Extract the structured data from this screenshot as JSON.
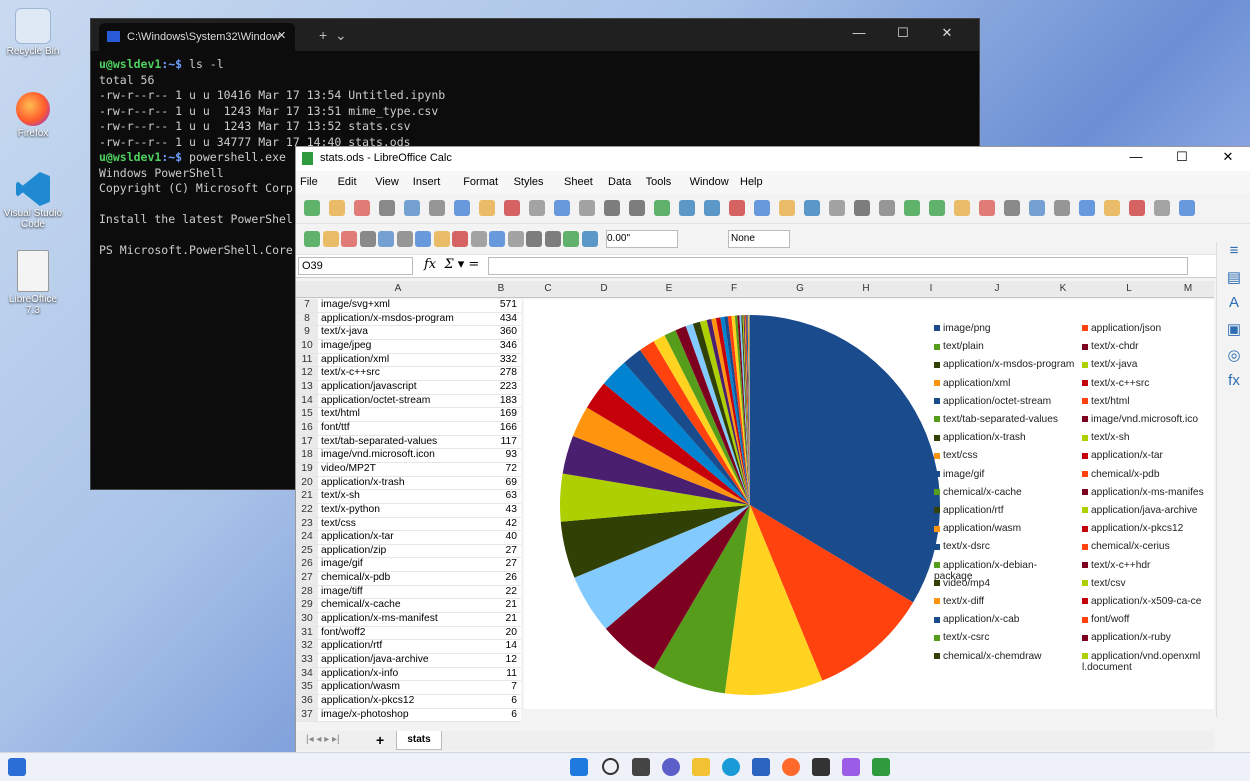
{
  "desktop": {
    "icons": [
      {
        "label": "Recycle Bin"
      },
      {
        "label": "Firefox"
      },
      {
        "label": "Visual Studio Code"
      },
      {
        "label": "LibreOffice 7.3"
      }
    ]
  },
  "terminal": {
    "tab_title": "C:\\Windows\\System32\\Window",
    "lines": [
      {
        "prompt": "u@wsldev1",
        "path": ":~$",
        "cmd": " ls -l"
      },
      {
        "text": "total 56"
      },
      {
        "text": "-rw-r--r-- 1 u u 10416 Mar 17 13:54 Untitled.ipynb"
      },
      {
        "text": "-rw-r--r-- 1 u u  1243 Mar 17 13:51 mime_type.csv"
      },
      {
        "text": "-rw-r--r-- 1 u u  1243 Mar 17 13:52 stats.csv"
      },
      {
        "text": "-rw-r--r-- 1 u u 34777 Mar 17 14:40 stats.ods"
      },
      {
        "prompt": "u@wsldev1",
        "path": ":~$",
        "cmd": " powershell.exe"
      },
      {
        "text": "Windows PowerShell"
      },
      {
        "text": "Copyright (C) Microsoft Corp"
      },
      {
        "text": ""
      },
      {
        "text": "Install the latest PowerShel"
      },
      {
        "text": ""
      },
      {
        "text": "PS Microsoft.PowerShell.Core"
      }
    ]
  },
  "calc": {
    "title": "stats.ods - LibreOffice Calc",
    "menu": [
      "File",
      "Edit",
      "View",
      "Insert",
      "Format",
      "Styles",
      "Sheet",
      "Data",
      "Tools",
      "Window",
      "Help"
    ],
    "cell_ref": "O39",
    "number_format": "0.00\"",
    "border_style": "None",
    "columns": [
      "A",
      "B",
      "C",
      "D",
      "E",
      "F",
      "G",
      "H",
      "I",
      "J",
      "K",
      "L",
      "M"
    ],
    "rows": [
      {
        "n": "7",
        "a": "image/svg+xml",
        "b": "571"
      },
      {
        "n": "8",
        "a": "application/x-msdos-program",
        "b": "434"
      },
      {
        "n": "9",
        "a": "text/x-java",
        "b": "360"
      },
      {
        "n": "10",
        "a": "image/jpeg",
        "b": "346"
      },
      {
        "n": "11",
        "a": "application/xml",
        "b": "332"
      },
      {
        "n": "12",
        "a": "text/x-c++src",
        "b": "278"
      },
      {
        "n": "13",
        "a": "application/javascript",
        "b": "223"
      },
      {
        "n": "14",
        "a": "application/octet-stream",
        "b": "183"
      },
      {
        "n": "15",
        "a": "text/html",
        "b": "169"
      },
      {
        "n": "16",
        "a": "font/ttf",
        "b": "166"
      },
      {
        "n": "17",
        "a": "text/tab-separated-values",
        "b": "117"
      },
      {
        "n": "18",
        "a": "image/vnd.microsoft.icon",
        "b": "93"
      },
      {
        "n": "19",
        "a": "video/MP2T",
        "b": "72"
      },
      {
        "n": "20",
        "a": "application/x-trash",
        "b": "69"
      },
      {
        "n": "21",
        "a": "text/x-sh",
        "b": "63"
      },
      {
        "n": "22",
        "a": "text/x-python",
        "b": "43"
      },
      {
        "n": "23",
        "a": "text/css",
        "b": "42"
      },
      {
        "n": "24",
        "a": "application/x-tar",
        "b": "40"
      },
      {
        "n": "25",
        "a": "application/zip",
        "b": "27"
      },
      {
        "n": "26",
        "a": "image/gif",
        "b": "27"
      },
      {
        "n": "27",
        "a": "chemical/x-pdb",
        "b": "26"
      },
      {
        "n": "28",
        "a": "image/tiff",
        "b": "22"
      },
      {
        "n": "29",
        "a": "chemical/x-cache",
        "b": "21"
      },
      {
        "n": "30",
        "a": "application/x-ms-manifest",
        "b": "21"
      },
      {
        "n": "31",
        "a": "font/woff2",
        "b": "20"
      },
      {
        "n": "32",
        "a": "application/rtf",
        "b": "14"
      },
      {
        "n": "33",
        "a": "application/java-archive",
        "b": "12"
      },
      {
        "n": "34",
        "a": "application/x-info",
        "b": "11"
      },
      {
        "n": "35",
        "a": "application/wasm",
        "b": "7"
      },
      {
        "n": "36",
        "a": "application/x-pkcs12",
        "b": "6"
      },
      {
        "n": "37",
        "a": "image/x-photoshop",
        "b": "6"
      }
    ],
    "sheet_tab": "stats"
  },
  "chart_data": {
    "type": "pie",
    "title": "",
    "series": [
      {
        "values": [
          2300,
          700,
          571,
          434,
          360,
          346,
          332,
          278,
          223,
          183,
          169,
          166,
          117,
          93,
          72,
          69,
          63,
          43,
          42,
          40,
          27,
          27,
          26,
          22,
          21,
          21,
          20,
          14,
          12,
          11,
          7,
          6,
          6,
          5,
          5,
          4,
          4,
          3,
          3,
          3,
          2,
          2
        ]
      }
    ],
    "colors": [
      "#1a4b8c",
      "#ff420e",
      "#ffd320",
      "#579d1c",
      "#7e0021",
      "#83caff",
      "#314004",
      "#aecf00",
      "#4b1f6f",
      "#ff950e",
      "#c5000b",
      "#0084d1",
      "#1a4b8c",
      "#ff420e",
      "#ffd320",
      "#579d1c",
      "#7e0021",
      "#83caff",
      "#314004",
      "#aecf00",
      "#4b1f6f",
      "#ff950e",
      "#c5000b",
      "#0084d1",
      "#1a4b8c",
      "#ff420e",
      "#ffd320",
      "#579d1c",
      "#7e0021",
      "#83caff",
      "#314004",
      "#aecf00",
      "#4b1f6f",
      "#ff950e",
      "#c5000b",
      "#0084d1",
      "#1a4b8c",
      "#ff420e",
      "#ffd320",
      "#579d1c",
      "#7e0021",
      "#83caff"
    ],
    "legend": [
      {
        "label": "image/png",
        "color": "#1a4b8c"
      },
      {
        "label": "application/json",
        "color": "#ff420e"
      },
      {
        "label": "text/plain",
        "color": "#579d1c"
      },
      {
        "label": "text/x-chdr",
        "color": "#7e0021"
      },
      {
        "label": "application/x-msdos-program",
        "color": "#314004"
      },
      {
        "label": "text/x-java",
        "color": "#aecf00"
      },
      {
        "label": "application/xml",
        "color": "#ff950e"
      },
      {
        "label": "text/x-c++src",
        "color": "#c5000b"
      },
      {
        "label": "application/octet-stream",
        "color": "#1a4b8c"
      },
      {
        "label": "text/html",
        "color": "#ff420e"
      },
      {
        "label": "text/tab-separated-values",
        "color": "#579d1c"
      },
      {
        "label": "image/vnd.microsoft.ico",
        "color": "#7e0021"
      },
      {
        "label": "application/x-trash",
        "color": "#314004"
      },
      {
        "label": "text/x-sh",
        "color": "#aecf00"
      },
      {
        "label": "text/css",
        "color": "#ff950e"
      },
      {
        "label": "application/x-tar",
        "color": "#c5000b"
      },
      {
        "label": "image/gif",
        "color": "#1a4b8c"
      },
      {
        "label": "chemical/x-pdb",
        "color": "#ff420e"
      },
      {
        "label": "chemical/x-cache",
        "color": "#579d1c"
      },
      {
        "label": "application/x-ms-manifes",
        "color": "#7e0021"
      },
      {
        "label": "application/rtf",
        "color": "#314004"
      },
      {
        "label": "application/java-archive",
        "color": "#aecf00"
      },
      {
        "label": "application/wasm",
        "color": "#ff950e"
      },
      {
        "label": "application/x-pkcs12",
        "color": "#c5000b"
      },
      {
        "label": "text/x-dsrc",
        "color": "#1a4b8c"
      },
      {
        "label": "chemical/x-cerius",
        "color": "#ff420e"
      },
      {
        "label": "application/x-debian-package",
        "color": "#579d1c"
      },
      {
        "label": "text/x-c++hdr",
        "color": "#7e0021"
      },
      {
        "label": "video/mp4",
        "color": "#314004"
      },
      {
        "label": "text/csv",
        "color": "#aecf00"
      },
      {
        "label": "text/x-diff",
        "color": "#ff950e"
      },
      {
        "label": "application/x-x509-ca-ce",
        "color": "#c5000b"
      },
      {
        "label": "application/x-cab",
        "color": "#1a4b8c"
      },
      {
        "label": "font/woff",
        "color": "#ff420e"
      },
      {
        "label": "text/x-csrc",
        "color": "#579d1c"
      },
      {
        "label": "application/x-ruby",
        "color": "#7e0021"
      },
      {
        "label": "chemical/x-chemdraw",
        "color": "#314004"
      },
      {
        "label": "application/vnd.openxml l.document",
        "color": "#aecf00"
      }
    ]
  }
}
